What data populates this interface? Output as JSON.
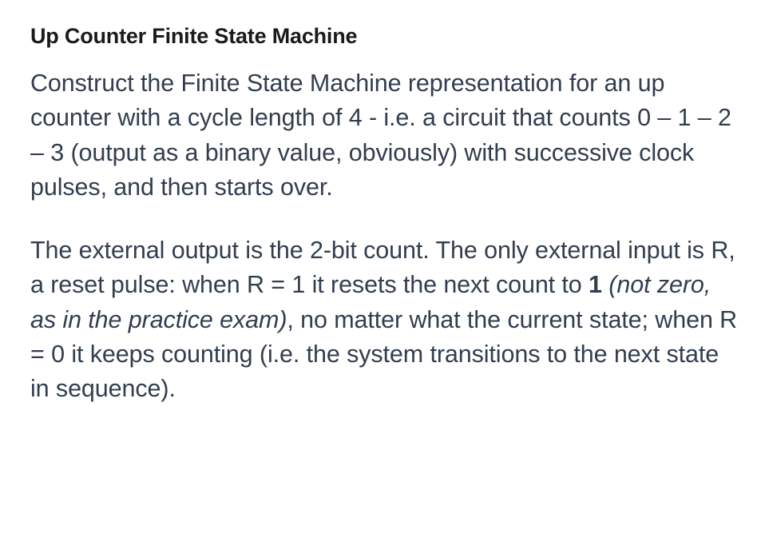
{
  "title": "Up Counter Finite State Machine",
  "paragraph1": "Construct the Finite State Machine representation for an up counter with a cycle length of 4 - i.e. a circuit that counts 0 – 1 – 2 – 3 (output as a binary value, obviously) with successive clock pulses, and then starts over.",
  "paragraph2": {
    "part1": "The external output is the 2-bit count. The only external input is R, a reset pulse: when R = 1 it resets the next count to ",
    "bold": "1",
    "italic1": " (not zero, as in the practice exam)",
    "part2": ", no matter what the current state; when R = 0 it keeps counting (i.e. the system transitions to the next state in sequence)."
  }
}
